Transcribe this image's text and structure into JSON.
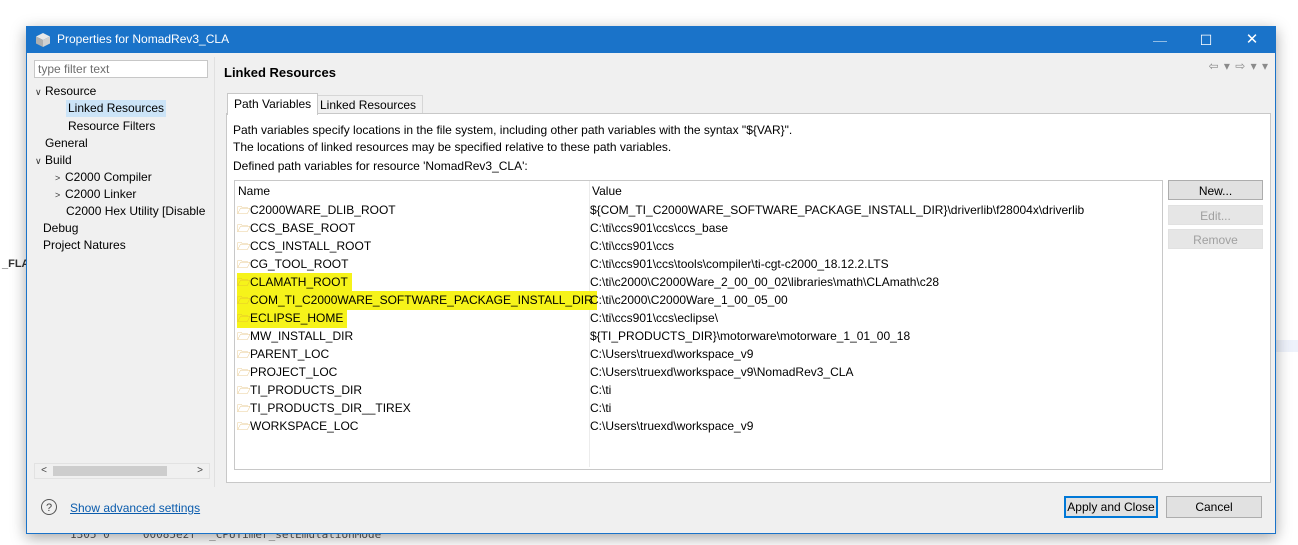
{
  "window": {
    "title": "Properties for NomadRev3_CLA",
    "minimize_glyph": "—",
    "maximize_glyph": "☐",
    "close_glyph": "✕"
  },
  "background": {
    "left_label": "_FLA",
    "code_line": "1305 0     00085e2f  _CPUTimer_setEmulationMode"
  },
  "sidebar": {
    "filter_placeholder": "type filter text",
    "items": [
      {
        "label": "Resource",
        "twisty": "∨"
      },
      {
        "label": "Linked Resources"
      },
      {
        "label": "Resource Filters"
      },
      {
        "label": "General"
      },
      {
        "label": "Build",
        "twisty": "∨"
      },
      {
        "label": "C2000 Compiler",
        "twisty": ">"
      },
      {
        "label": "C2000 Linker",
        "twisty": ">"
      },
      {
        "label": "C2000 Hex Utility  [Disable"
      },
      {
        "label": "Debug"
      },
      {
        "label": "Project Natures"
      }
    ]
  },
  "page": {
    "title": "Linked Resources",
    "nav": "⇦ ▾ ⇨ ▾ ▾"
  },
  "tabs": [
    {
      "label": "Path Variables"
    },
    {
      "label": "Linked Resources"
    }
  ],
  "description": {
    "line1": "Path variables specify locations in the file system, including other path variables with the syntax \"${VAR}\".",
    "line2": "The locations of linked resources may be specified relative to these path variables.",
    "line3": "Defined path variables for resource 'NomadRev3_CLA':"
  },
  "table": {
    "headers": {
      "name": "Name",
      "value": "Value"
    },
    "rows": [
      {
        "name": "C2000WARE_DLIB_ROOT",
        "value": "${COM_TI_C2000WARE_SOFTWARE_PACKAGE_INSTALL_DIR}\\driverlib\\f28004x\\driverlib",
        "highlighted": false
      },
      {
        "name": "CCS_BASE_ROOT",
        "value": "C:\\ti\\ccs901\\ccs\\ccs_base",
        "highlighted": false
      },
      {
        "name": "CCS_INSTALL_ROOT",
        "value": "C:\\ti\\ccs901\\ccs",
        "highlighted": false
      },
      {
        "name": "CG_TOOL_ROOT",
        "value": "C:\\ti\\ccs901\\ccs\\tools\\compiler\\ti-cgt-c2000_18.12.2.LTS",
        "highlighted": false
      },
      {
        "name": "CLAMATH_ROOT",
        "value": "C:\\ti\\c2000\\C2000Ware_2_00_00_02\\libraries\\math\\CLAmath\\c28",
        "highlighted": true
      },
      {
        "name": "COM_TI_C2000WARE_SOFTWARE_PACKAGE_INSTALL_DIR",
        "value": "C:\\ti\\c2000\\C2000Ware_1_00_05_00",
        "highlighted": true
      },
      {
        "name": "ECLIPSE_HOME",
        "value": "C:\\ti\\ccs901\\ccs\\eclipse\\",
        "highlighted": true
      },
      {
        "name": "MW_INSTALL_DIR",
        "value": "${TI_PRODUCTS_DIR}\\motorware\\motorware_1_01_00_18",
        "highlighted": false
      },
      {
        "name": "PARENT_LOC",
        "value": "C:\\Users\\truexd\\workspace_v9",
        "highlighted": false
      },
      {
        "name": "PROJECT_LOC",
        "value": "C:\\Users\\truexd\\workspace_v9\\NomadRev3_CLA",
        "highlighted": false
      },
      {
        "name": "TI_PRODUCTS_DIR",
        "value": "C:\\ti",
        "highlighted": false
      },
      {
        "name": "TI_PRODUCTS_DIR__TIREX",
        "value": "C:\\ti",
        "highlighted": false
      },
      {
        "name": "WORKSPACE_LOC",
        "value": "C:\\Users\\truexd\\workspace_v9",
        "highlighted": false
      }
    ]
  },
  "side_buttons": {
    "new": "New...",
    "edit": "Edit...",
    "remove": "Remove"
  },
  "footer": {
    "help_glyph": "?",
    "advanced_link": "Show advanced settings",
    "apply_close": "Apply and Close",
    "cancel": "Cancel"
  },
  "colors": {
    "titlebar": "#1a73c9",
    "highlight": "#f6f31a",
    "selection": "#cce4f7",
    "link": "#0b5cad"
  }
}
